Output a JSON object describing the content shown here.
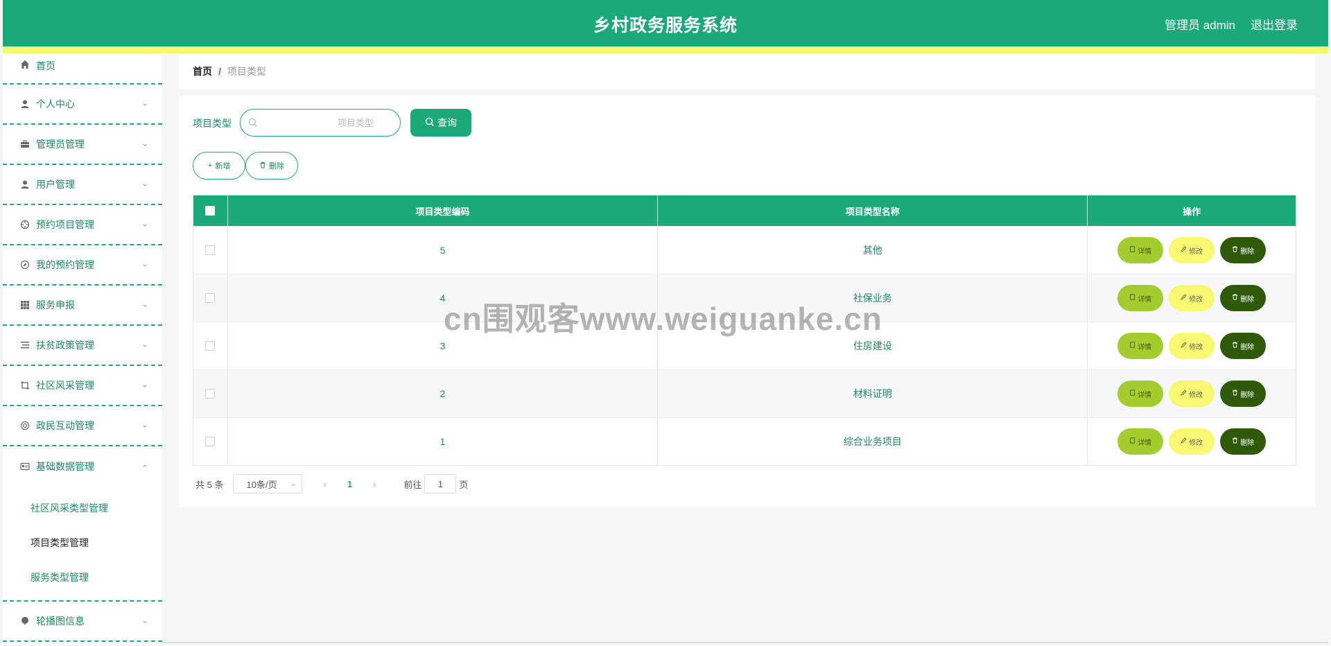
{
  "header": {
    "title": "乡村政务服务系统",
    "user": "管理员 admin",
    "logout": "退出登录"
  },
  "sidebar": {
    "items": [
      {
        "label": "首页",
        "icon": "home-icon"
      },
      {
        "label": "个人中心",
        "icon": "user-icon"
      },
      {
        "label": "管理员管理",
        "icon": "briefcase-icon"
      },
      {
        "label": "用户管理",
        "icon": "user-icon"
      },
      {
        "label": "预约项目管理",
        "icon": "crosshair-icon"
      },
      {
        "label": "我的预约管理",
        "icon": "compass-icon"
      },
      {
        "label": "服务申报",
        "icon": "grid-icon"
      },
      {
        "label": "扶贫政策管理",
        "icon": "list-icon"
      },
      {
        "label": "社区风采管理",
        "icon": "crop-icon"
      },
      {
        "label": "政民互动管理",
        "icon": "lifebuoy-icon"
      },
      {
        "label": "基础数据管理",
        "icon": "id-card-icon"
      },
      {
        "label": "轮播图信息",
        "icon": "balloon-icon"
      }
    ],
    "submenu": [
      {
        "label": "社区风采类型管理"
      },
      {
        "label": "项目类型管理"
      },
      {
        "label": "服务类型管理"
      }
    ]
  },
  "breadcrumb": {
    "home": "首页",
    "separator": "/",
    "current": "项目类型"
  },
  "search": {
    "label": "项目类型",
    "placeholder": "项目类型",
    "button": "查询"
  },
  "actions": {
    "add": "新增",
    "delete": "删除"
  },
  "table": {
    "columns": [
      "项目类型编码",
      "项目类型名称",
      "操作"
    ],
    "rows": [
      {
        "code": "5",
        "name": "其他"
      },
      {
        "code": "4",
        "name": "社保业务"
      },
      {
        "code": "3",
        "name": "住房建设"
      },
      {
        "code": "2",
        "name": "材料证明"
      },
      {
        "code": "1",
        "name": "综合业务项目"
      }
    ],
    "row_buttons": {
      "detail": "详情",
      "edit": "修改",
      "delete": "删除"
    }
  },
  "pagination": {
    "total": "共 5 条",
    "page_size": "10条/页",
    "current_page": "1",
    "goto_label": "前往",
    "goto_value": "1",
    "page_suffix": "页"
  },
  "watermark": "cn围观客www.weiguanke.cn",
  "colors": {
    "primary": "#1aaa77",
    "stripe": "#f8f870",
    "detail_button": "#a3cc2e",
    "edit_button": "#f8f870",
    "delete_button": "#2f5a0a"
  }
}
